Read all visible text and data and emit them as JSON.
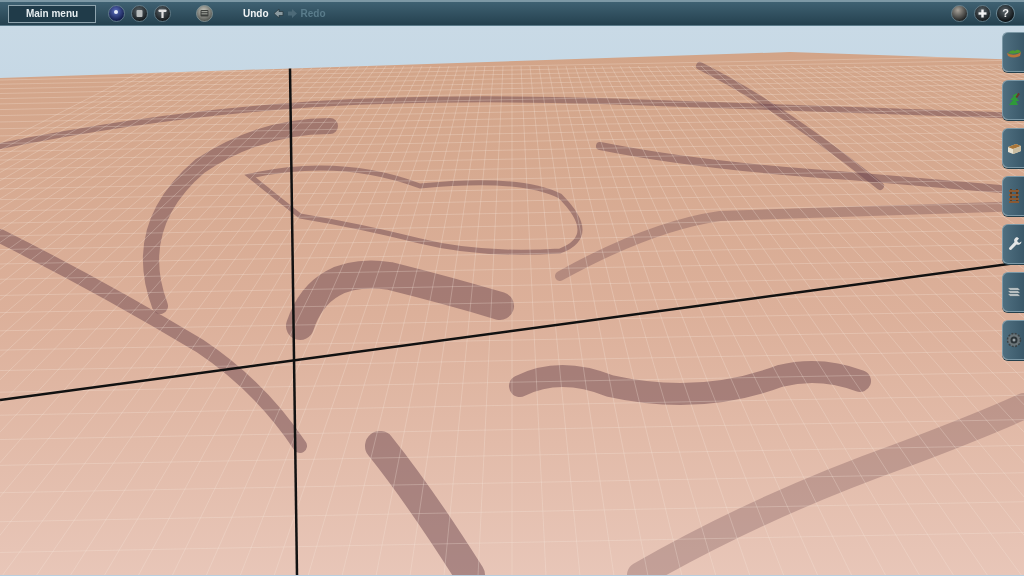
{
  "toolbar": {
    "main_menu": "Main menu",
    "undo": {
      "label": "Undo",
      "disabled": false
    },
    "redo": {
      "label": "Redo",
      "disabled": true
    },
    "help": "?"
  }
}
